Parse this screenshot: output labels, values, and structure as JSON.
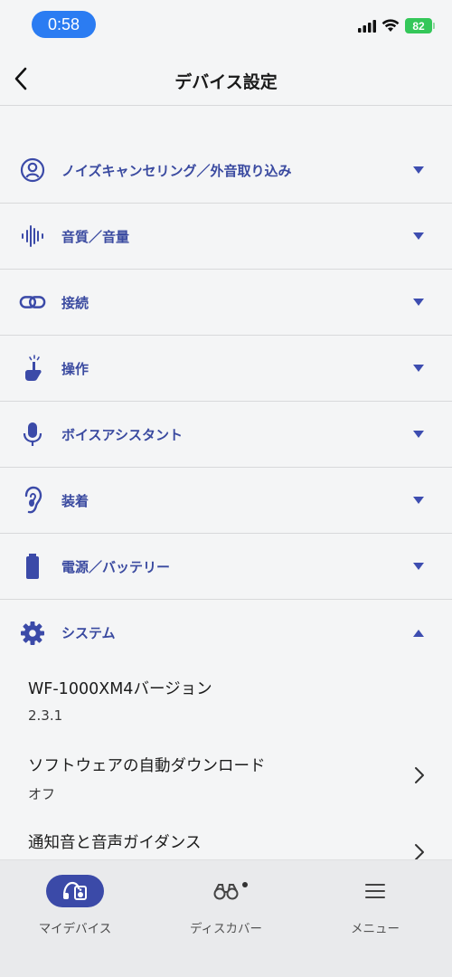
{
  "status_bar": {
    "time": "0:58",
    "battery": "82"
  },
  "header": {
    "title": "デバイス設定"
  },
  "sections": [
    {
      "label": "ノイズキャンセリング／外音取り込み",
      "icon": "person-circle-icon"
    },
    {
      "label": "音質／音量",
      "icon": "sound-wave-icon"
    },
    {
      "label": "接続",
      "icon": "link-icon"
    },
    {
      "label": "操作",
      "icon": "tap-finger-icon"
    },
    {
      "label": "ボイスアシスタント",
      "icon": "microphone-icon"
    },
    {
      "label": "装着",
      "icon": "ear-icon"
    },
    {
      "label": "電源／バッテリー",
      "icon": "battery-icon"
    },
    {
      "label": "システム",
      "icon": "gear-icon",
      "expanded": true
    }
  ],
  "system_items": [
    {
      "title": "WF-1000XM4バージョン",
      "value": "2.3.1"
    },
    {
      "title": "ソフトウェアの自動ダウンロード",
      "value": "オフ"
    },
    {
      "title": "通知音と音声ガイダンス",
      "value": ""
    }
  ],
  "bottom_nav": [
    {
      "label": "マイデバイス",
      "icon": "headphones-device-icon",
      "active": true
    },
    {
      "label": "ディスカバー",
      "icon": "binoculars-icon"
    },
    {
      "label": "メニュー",
      "icon": "hamburger-menu-icon"
    }
  ],
  "colors": {
    "accent": "#3b4aa8",
    "time_pill": "#2b7cf2",
    "battery": "#34c759"
  }
}
